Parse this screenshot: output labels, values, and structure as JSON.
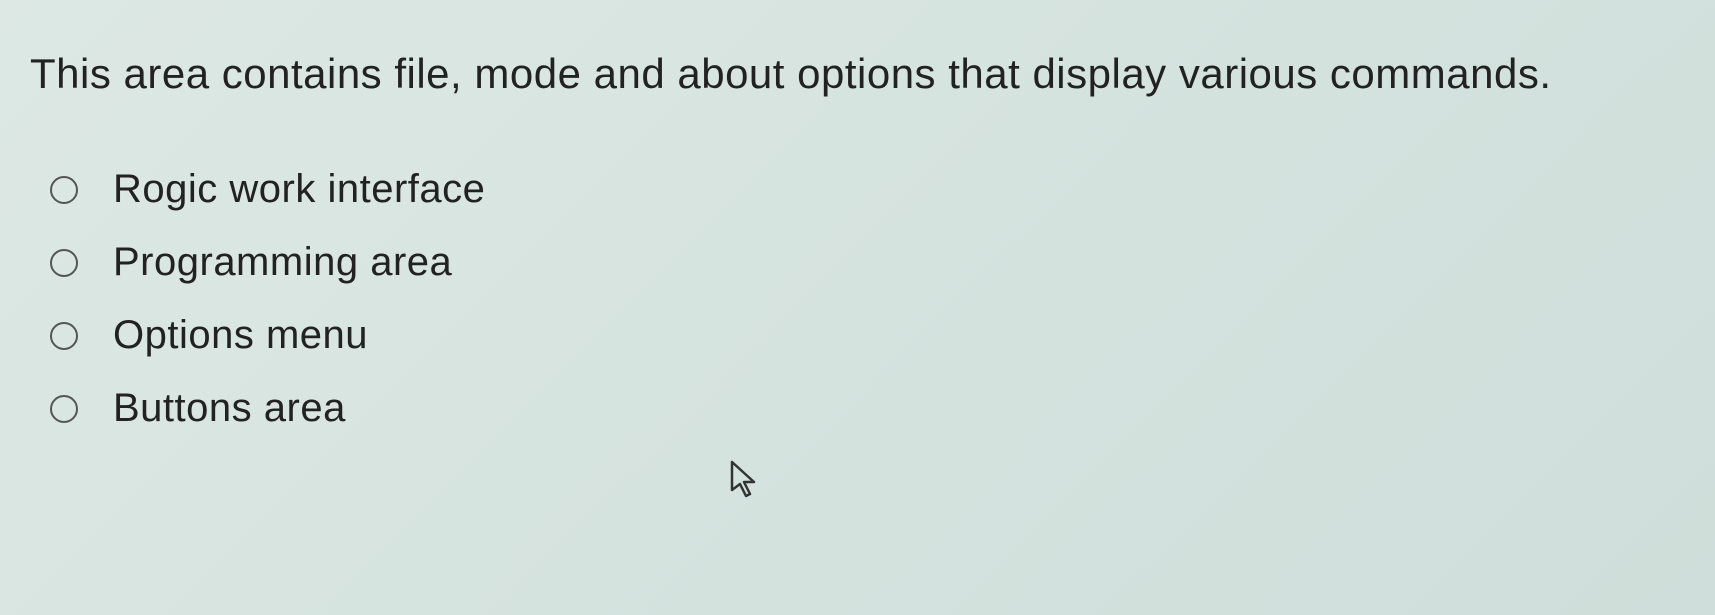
{
  "question": {
    "text": "This area contains file, mode and about options that display various commands."
  },
  "options": [
    {
      "label": "Rogic work interface",
      "selected": false
    },
    {
      "label": "Programming area",
      "selected": false
    },
    {
      "label": "Options menu",
      "selected": false
    },
    {
      "label": "Buttons area",
      "selected": false
    }
  ]
}
